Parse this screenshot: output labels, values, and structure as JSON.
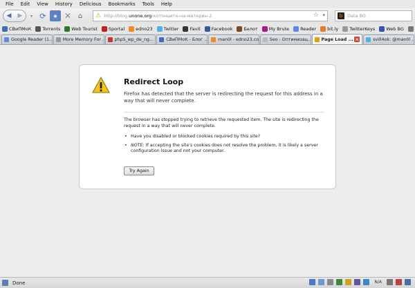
{
  "menu": [
    "File",
    "Edit",
    "View",
    "History",
    "Delicious",
    "Bookmarks",
    "Tools",
    "Help"
  ],
  "url": {
    "prefix": "http://blog.",
    "domain": "unone.org",
    "path": "/котонците-на-материн-2"
  },
  "search": {
    "placeholder": "Data BG"
  },
  "bookmarks": [
    {
      "label": "СВиПМоК",
      "color": "#3b6fb6"
    },
    {
      "label": "Torrents",
      "color": "#555"
    },
    {
      "label": "Web Tourist",
      "color": "#2a7a2a"
    },
    {
      "label": "Sportal",
      "color": "#c21f1f"
    },
    {
      "label": "edno23",
      "color": "#f08b1d"
    },
    {
      "label": "Twitter",
      "color": "#4ab3e8"
    },
    {
      "label": "Favit",
      "color": "#333"
    },
    {
      "label": "Facebook",
      "color": "#3b5998"
    },
    {
      "label": "Белот",
      "color": "#7a4a1a"
    },
    {
      "label": "My Brute",
      "color": "#a51d8a"
    },
    {
      "label": "Reader",
      "color": "#5a8be0"
    },
    {
      "label": "bit.ly",
      "color": "#e57d1f"
    },
    {
      "label": "TwitterKeys",
      "color": "#999"
    },
    {
      "label": "Web BG",
      "color": "#3355aa"
    },
    {
      "label": "Пред.",
      "color": "#777"
    }
  ],
  "tabs": [
    {
      "label": "Google Reader (1...",
      "color": "#5a8be0",
      "active": false
    },
    {
      "label": "More Memory For ...",
      "color": "#999",
      "active": false
    },
    {
      "label": "phpS_wp_de_ng...",
      "color": "#c33",
      "active": false
    },
    {
      "label": "СВиПМоК - Блог ...",
      "color": "#3b6fb6",
      "active": false
    },
    {
      "label": "man0l - edno23.co...",
      "color": "#f08b1d",
      "active": false
    },
    {
      "label": "Seo - Оптимизац...",
      "color": "#bbb",
      "active": false
    },
    {
      "label": "Page Load ...",
      "color": "#d9a300",
      "active": true
    },
    {
      "label": "svill4ok: @man0l ...",
      "color": "#4ab3e8",
      "active": false
    }
  ],
  "error": {
    "title": "Redirect Loop",
    "short": "Firefox has detected that the server is redirecting the request for this address in a way that will never complete.",
    "long": "The browser has stopped trying to retrieve the requested item. The site is redirecting the request in a way that will never complete.",
    "bullet1": "Have you disabled or blocked cookies required by this site?",
    "bullet2_label": "NOTE:",
    "bullet2_text": " If accepting the site's cookies does not resolve the problem, it is likely a server configuration issue and not your computer.",
    "button": "Try Again"
  },
  "status": {
    "text": "Done",
    "na": "N/A"
  }
}
